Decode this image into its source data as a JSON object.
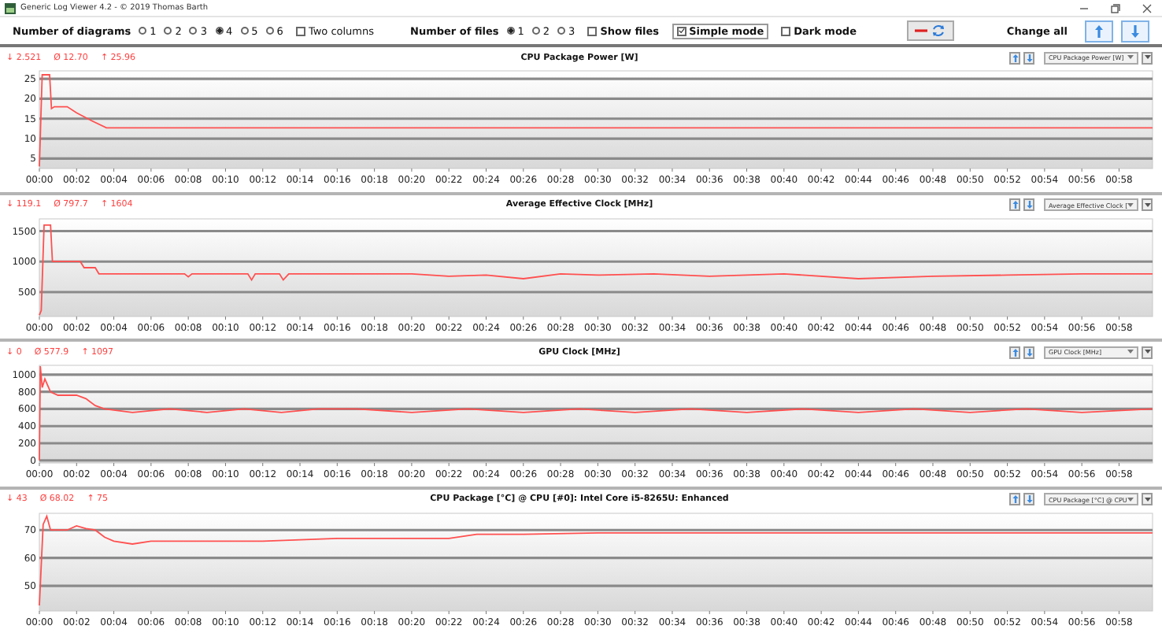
{
  "window": {
    "title": "Generic Log Viewer 4.2 - © 2019 Thomas Barth"
  },
  "toolbar": {
    "diagrams_label": "Number of diagrams",
    "diagram_options": [
      {
        "label": "1",
        "selected": false
      },
      {
        "label": "2",
        "selected": false
      },
      {
        "label": "3",
        "selected": false
      },
      {
        "label": "4",
        "selected": true
      },
      {
        "label": "5",
        "selected": false
      },
      {
        "label": "6",
        "selected": false
      }
    ],
    "two_columns": {
      "label": "Two columns",
      "checked": false
    },
    "files_label": "Number of files",
    "file_options": [
      {
        "label": "1",
        "selected": true
      },
      {
        "label": "2",
        "selected": false
      },
      {
        "label": "3",
        "selected": false
      }
    ],
    "show_files": {
      "label": "Show files",
      "checked": false
    },
    "simple_mode": {
      "label": "Simple mode",
      "checked": true
    },
    "dark_mode": {
      "label": "Dark mode",
      "checked": false
    },
    "change_all_label": "Change all"
  },
  "panels": [
    {
      "min": "↓ 2.521",
      "avg": "Ø 12.70",
      "max": "↑ 25.96",
      "title": "CPU Package Power [W]",
      "sensor": "CPU Package Power [W]",
      "chart_data": {
        "type": "line",
        "grid": true,
        "xlim": [
          0,
          59.8
        ],
        "ylim": [
          2.5,
          27
        ],
        "yticks": [
          5,
          10,
          15,
          20,
          25
        ],
        "xticks": [
          {
            "value": 0,
            "label": "00:00"
          },
          {
            "value": 2,
            "label": "00:02"
          },
          {
            "value": 4,
            "label": "00:04"
          },
          {
            "value": 6,
            "label": "00:06"
          },
          {
            "value": 8,
            "label": "00:08"
          },
          {
            "value": 10,
            "label": "00:10"
          },
          {
            "value": 12,
            "label": "00:12"
          },
          {
            "value": 14,
            "label": "00:14"
          },
          {
            "value": 16,
            "label": "00:16"
          },
          {
            "value": 18,
            "label": "00:18"
          },
          {
            "value": 20,
            "label": "00:20"
          },
          {
            "value": 22,
            "label": "00:22"
          },
          {
            "value": 24,
            "label": "00:24"
          },
          {
            "value": 26,
            "label": "00:26"
          },
          {
            "value": 28,
            "label": "00:28"
          },
          {
            "value": 30,
            "label": "00:30"
          },
          {
            "value": 32,
            "label": "00:32"
          },
          {
            "value": 34,
            "label": "00:34"
          },
          {
            "value": 36,
            "label": "00:36"
          },
          {
            "value": 38,
            "label": "00:38"
          },
          {
            "value": 40,
            "label": "00:40"
          },
          {
            "value": 42,
            "label": "00:42"
          },
          {
            "value": 44,
            "label": "00:44"
          },
          {
            "value": 46,
            "label": "00:46"
          },
          {
            "value": 48,
            "label": "00:48"
          },
          {
            "value": 50,
            "label": "00:50"
          },
          {
            "value": 52,
            "label": "00:52"
          },
          {
            "value": 54,
            "label": "00:54"
          },
          {
            "value": 56,
            "label": "00:56"
          },
          {
            "value": 58,
            "label": "00:58"
          }
        ],
        "x": [
          0,
          0.15,
          0.3,
          0.55,
          0.65,
          0.8,
          1.5,
          2,
          2.8,
          3.6,
          10,
          20,
          30,
          40,
          50,
          59.8
        ],
        "series": [
          {
            "color": "#ff5050",
            "values": [
              3,
              26,
              26,
              26,
              17.5,
              18,
              18,
              16.5,
              14.5,
              12.7,
              12.7,
              12.7,
              12.7,
              12.7,
              12.7,
              12.7
            ]
          }
        ]
      }
    },
    {
      "min": "↓ 119.1",
      "avg": "Ø 797.7",
      "max": "↑ 1604",
      "title": "Average Effective Clock [MHz]",
      "sensor": "Average Effective Clock [",
      "chart_data": {
        "type": "line",
        "grid": true,
        "xlim": [
          0,
          59.8
        ],
        "ylim": [
          100,
          1700
        ],
        "yticks": [
          500,
          1000,
          1500
        ],
        "xticks": [
          {
            "value": 0,
            "label": "00:00"
          },
          {
            "value": 2,
            "label": "00:02"
          },
          {
            "value": 4,
            "label": "00:04"
          },
          {
            "value": 6,
            "label": "00:06"
          },
          {
            "value": 8,
            "label": "00:08"
          },
          {
            "value": 10,
            "label": "00:10"
          },
          {
            "value": 12,
            "label": "00:12"
          },
          {
            "value": 14,
            "label": "00:14"
          },
          {
            "value": 16,
            "label": "00:16"
          },
          {
            "value": 18,
            "label": "00:18"
          },
          {
            "value": 20,
            "label": "00:20"
          },
          {
            "value": 22,
            "label": "00:22"
          },
          {
            "value": 24,
            "label": "00:24"
          },
          {
            "value": 26,
            "label": "00:26"
          },
          {
            "value": 28,
            "label": "00:28"
          },
          {
            "value": 30,
            "label": "00:30"
          },
          {
            "value": 32,
            "label": "00:32"
          },
          {
            "value": 34,
            "label": "00:34"
          },
          {
            "value": 36,
            "label": "00:36"
          },
          {
            "value": 38,
            "label": "00:38"
          },
          {
            "value": 40,
            "label": "00:40"
          },
          {
            "value": 42,
            "label": "00:42"
          },
          {
            "value": 44,
            "label": "00:44"
          },
          {
            "value": 46,
            "label": "00:46"
          },
          {
            "value": 48,
            "label": "00:48"
          },
          {
            "value": 50,
            "label": "00:50"
          },
          {
            "value": 52,
            "label": "00:52"
          },
          {
            "value": 54,
            "label": "00:54"
          },
          {
            "value": 56,
            "label": "00:56"
          },
          {
            "value": 58,
            "label": "00:58"
          }
        ],
        "x": [
          0,
          0.1,
          0.25,
          0.6,
          0.7,
          2.2,
          2.4,
          3,
          3.2,
          7.8,
          8,
          8.2,
          11.2,
          11.4,
          11.6,
          12.9,
          13.1,
          13.4,
          20,
          22,
          24,
          26,
          28,
          30,
          33,
          36,
          40,
          44,
          48,
          52,
          56,
          59.8
        ],
        "series": [
          {
            "color": "#ff5050",
            "values": [
              120,
              200,
              1600,
              1600,
              1000,
              1000,
              900,
              900,
              800,
              800,
              750,
              800,
              800,
              700,
              800,
              800,
              700,
              800,
              800,
              760,
              780,
              720,
              800,
              780,
              800,
              760,
              800,
              720,
              760,
              780,
              800,
              800
            ]
          }
        ]
      }
    },
    {
      "min": "↓ 0",
      "avg": "Ø 577.9",
      "max": "↑ 1097",
      "title": "GPU Clock [MHz]",
      "sensor": "GPU Clock [MHz]",
      "chart_data": {
        "type": "line",
        "grid": true,
        "xlim": [
          0,
          59.8
        ],
        "ylim": [
          -30,
          1110
        ],
        "yticks": [
          0,
          200,
          400,
          600,
          800,
          1000
        ],
        "xticks": [
          {
            "value": 0,
            "label": "00:00"
          },
          {
            "value": 2,
            "label": "00:02"
          },
          {
            "value": 4,
            "label": "00:04"
          },
          {
            "value": 6,
            "label": "00:06"
          },
          {
            "value": 8,
            "label": "00:08"
          },
          {
            "value": 10,
            "label": "00:10"
          },
          {
            "value": 12,
            "label": "00:12"
          },
          {
            "value": 14,
            "label": "00:14"
          },
          {
            "value": 16,
            "label": "00:16"
          },
          {
            "value": 18,
            "label": "00:18"
          },
          {
            "value": 20,
            "label": "00:20"
          },
          {
            "value": 22,
            "label": "00:22"
          },
          {
            "value": 24,
            "label": "00:24"
          },
          {
            "value": 26,
            "label": "00:26"
          },
          {
            "value": 28,
            "label": "00:28"
          },
          {
            "value": 30,
            "label": "00:30"
          },
          {
            "value": 32,
            "label": "00:32"
          },
          {
            "value": 34,
            "label": "00:34"
          },
          {
            "value": 36,
            "label": "00:36"
          },
          {
            "value": 38,
            "label": "00:38"
          },
          {
            "value": 40,
            "label": "00:40"
          },
          {
            "value": 42,
            "label": "00:42"
          },
          {
            "value": 44,
            "label": "00:44"
          },
          {
            "value": 46,
            "label": "00:46"
          },
          {
            "value": 48,
            "label": "00:48"
          },
          {
            "value": 50,
            "label": "00:50"
          },
          {
            "value": 52,
            "label": "00:52"
          },
          {
            "value": 54,
            "label": "00:54"
          },
          {
            "value": 56,
            "label": "00:56"
          },
          {
            "value": 58,
            "label": "00:58"
          }
        ],
        "x": [
          0,
          0.05,
          0.15,
          0.3,
          0.6,
          1,
          2,
          2.5,
          3,
          3.5,
          5,
          7,
          9,
          11,
          13,
          15,
          17,
          20,
          23,
          26,
          29,
          32,
          35,
          38,
          41,
          44,
          47,
          50,
          53,
          56,
          59.8
        ],
        "series": [
          {
            "color": "#ff5050",
            "values": [
              0,
              1100,
              850,
              950,
              800,
              760,
              760,
              720,
              640,
              600,
              560,
              600,
              560,
              600,
              560,
              600,
              600,
              560,
              600,
              560,
              600,
              560,
              600,
              560,
              600,
              560,
              600,
              560,
              600,
              560,
              600
            ]
          }
        ]
      }
    },
    {
      "min": "↓ 43",
      "avg": "Ø 68.02",
      "max": "↑ 75",
      "title": "CPU Package [°C] @ CPU [#0]: Intel Core i5-8265U: Enhanced",
      "sensor": "CPU Package [°C] @ CPU",
      "chart_data": {
        "type": "line",
        "grid": true,
        "xlim": [
          0,
          59.8
        ],
        "ylim": [
          41,
          76
        ],
        "yticks": [
          50,
          60,
          70
        ],
        "xticks": [
          {
            "value": 0,
            "label": "00:00"
          },
          {
            "value": 2,
            "label": "00:02"
          },
          {
            "value": 4,
            "label": "00:04"
          },
          {
            "value": 6,
            "label": "00:06"
          },
          {
            "value": 8,
            "label": "00:08"
          },
          {
            "value": 10,
            "label": "00:10"
          },
          {
            "value": 12,
            "label": "00:12"
          },
          {
            "value": 14,
            "label": "00:14"
          },
          {
            "value": 16,
            "label": "00:16"
          },
          {
            "value": 18,
            "label": "00:18"
          },
          {
            "value": 20,
            "label": "00:20"
          },
          {
            "value": 22,
            "label": "00:22"
          },
          {
            "value": 24,
            "label": "00:24"
          },
          {
            "value": 26,
            "label": "00:26"
          },
          {
            "value": 28,
            "label": "00:28"
          },
          {
            "value": 30,
            "label": "00:30"
          },
          {
            "value": 32,
            "label": "00:32"
          },
          {
            "value": 34,
            "label": "00:34"
          },
          {
            "value": 36,
            "label": "00:36"
          },
          {
            "value": 38,
            "label": "00:38"
          },
          {
            "value": 40,
            "label": "00:40"
          },
          {
            "value": 42,
            "label": "00:42"
          },
          {
            "value": 44,
            "label": "00:44"
          },
          {
            "value": 46,
            "label": "00:46"
          },
          {
            "value": 48,
            "label": "00:48"
          },
          {
            "value": 50,
            "label": "00:50"
          },
          {
            "value": 52,
            "label": "00:52"
          },
          {
            "value": 54,
            "label": "00:54"
          },
          {
            "value": 56,
            "label": "00:56"
          },
          {
            "value": 58,
            "label": "00:58"
          }
        ],
        "x": [
          0,
          0.2,
          0.4,
          0.6,
          1,
          1.5,
          2,
          2.5,
          3,
          3.5,
          4,
          5,
          6,
          8,
          10,
          12,
          14,
          16,
          18,
          20,
          22,
          23.5,
          26,
          30,
          35,
          40,
          45,
          50,
          55,
          59.8
        ],
        "series": [
          {
            "color": "#ff5050",
            "values": [
              43,
              72,
              75,
              70,
              70,
              70,
              71.5,
              70.5,
              70,
              67.5,
              66,
              65,
              66,
              66,
              66,
              66,
              66.5,
              67,
              67,
              67,
              67,
              68.5,
              68.5,
              69,
              69,
              69,
              69,
              69,
              69,
              69
            ]
          }
        ]
      }
    }
  ]
}
